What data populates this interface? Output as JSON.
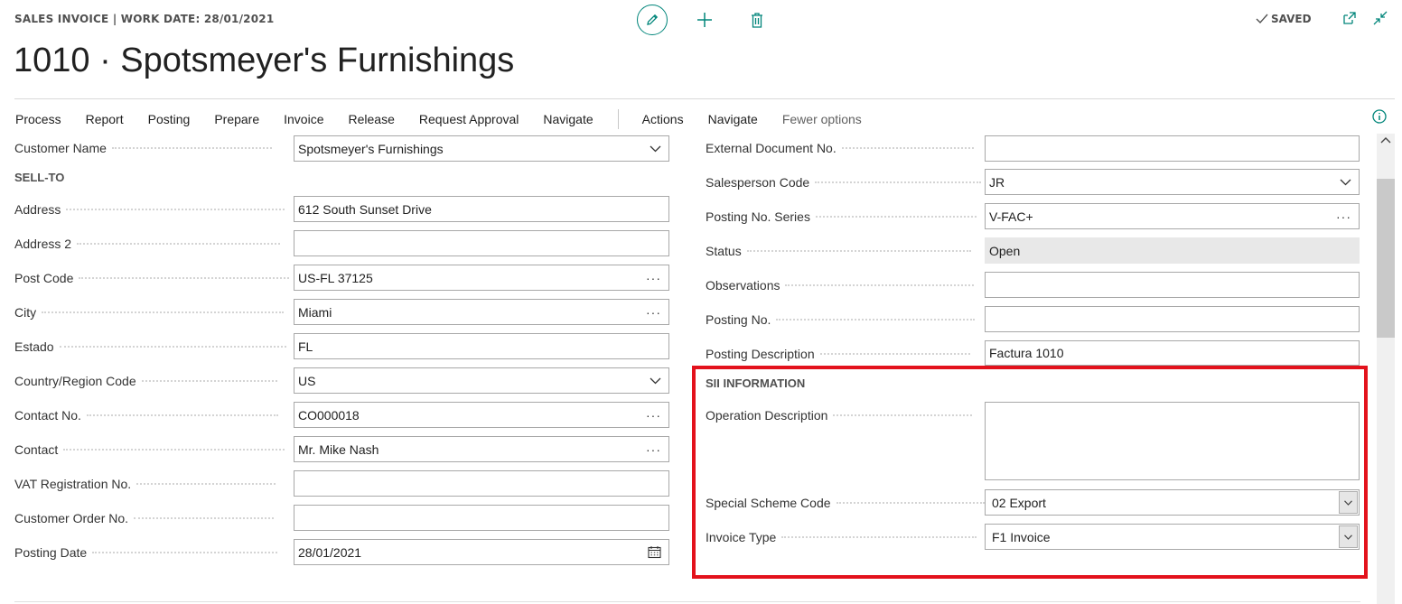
{
  "header": {
    "context": "SALES INVOICE | WORK DATE: 28/01/2021",
    "saved_label": "SAVED",
    "title": "1010 · Spotsmeyer's Furnishings"
  },
  "actions": {
    "items": [
      "Process",
      "Report",
      "Posting",
      "Prepare",
      "Invoice",
      "Release",
      "Request Approval",
      "Navigate"
    ],
    "secondary": [
      "Actions",
      "Navigate"
    ],
    "fewer_options": "Fewer options"
  },
  "left": {
    "customer_name": {
      "label": "Customer Name",
      "value": "Spotsmeyer's Furnishings"
    },
    "sell_to_heading": "SELL-TO",
    "address": {
      "label": "Address",
      "value": "612 South Sunset Drive"
    },
    "address2": {
      "label": "Address 2",
      "value": ""
    },
    "post_code": {
      "label": "Post Code",
      "value": "US-FL 37125"
    },
    "city": {
      "label": "City",
      "value": "Miami"
    },
    "estado": {
      "label": "Estado",
      "value": "FL"
    },
    "country": {
      "label": "Country/Region Code",
      "value": "US"
    },
    "contact_no": {
      "label": "Contact No.",
      "value": "CO000018"
    },
    "contact": {
      "label": "Contact",
      "value": "Mr. Mike Nash"
    },
    "vat": {
      "label": "VAT Registration No.",
      "value": ""
    },
    "customer_order": {
      "label": "Customer Order No.",
      "value": ""
    },
    "posting_date": {
      "label": "Posting Date",
      "value": "28/01/2021"
    }
  },
  "right": {
    "ext_doc": {
      "label": "External Document No.",
      "value": ""
    },
    "salesperson": {
      "label": "Salesperson Code",
      "value": "JR"
    },
    "posting_series": {
      "label": "Posting No. Series",
      "value": "V-FAC+"
    },
    "status": {
      "label": "Status",
      "value": "Open"
    },
    "observations": {
      "label": "Observations",
      "value": ""
    },
    "posting_no": {
      "label": "Posting No.",
      "value": ""
    },
    "posting_desc": {
      "label": "Posting Description",
      "value": "Factura 1010"
    }
  },
  "sii": {
    "heading": "SII INFORMATION",
    "operation": {
      "label": "Operation Description",
      "value": ""
    },
    "scheme": {
      "label": "Special Scheme Code",
      "value": "02 Export"
    },
    "invoice_type": {
      "label": "Invoice Type",
      "value": "F1 Invoice"
    }
  },
  "colors": {
    "accent": "#00857a",
    "highlight": "#e3121c"
  }
}
